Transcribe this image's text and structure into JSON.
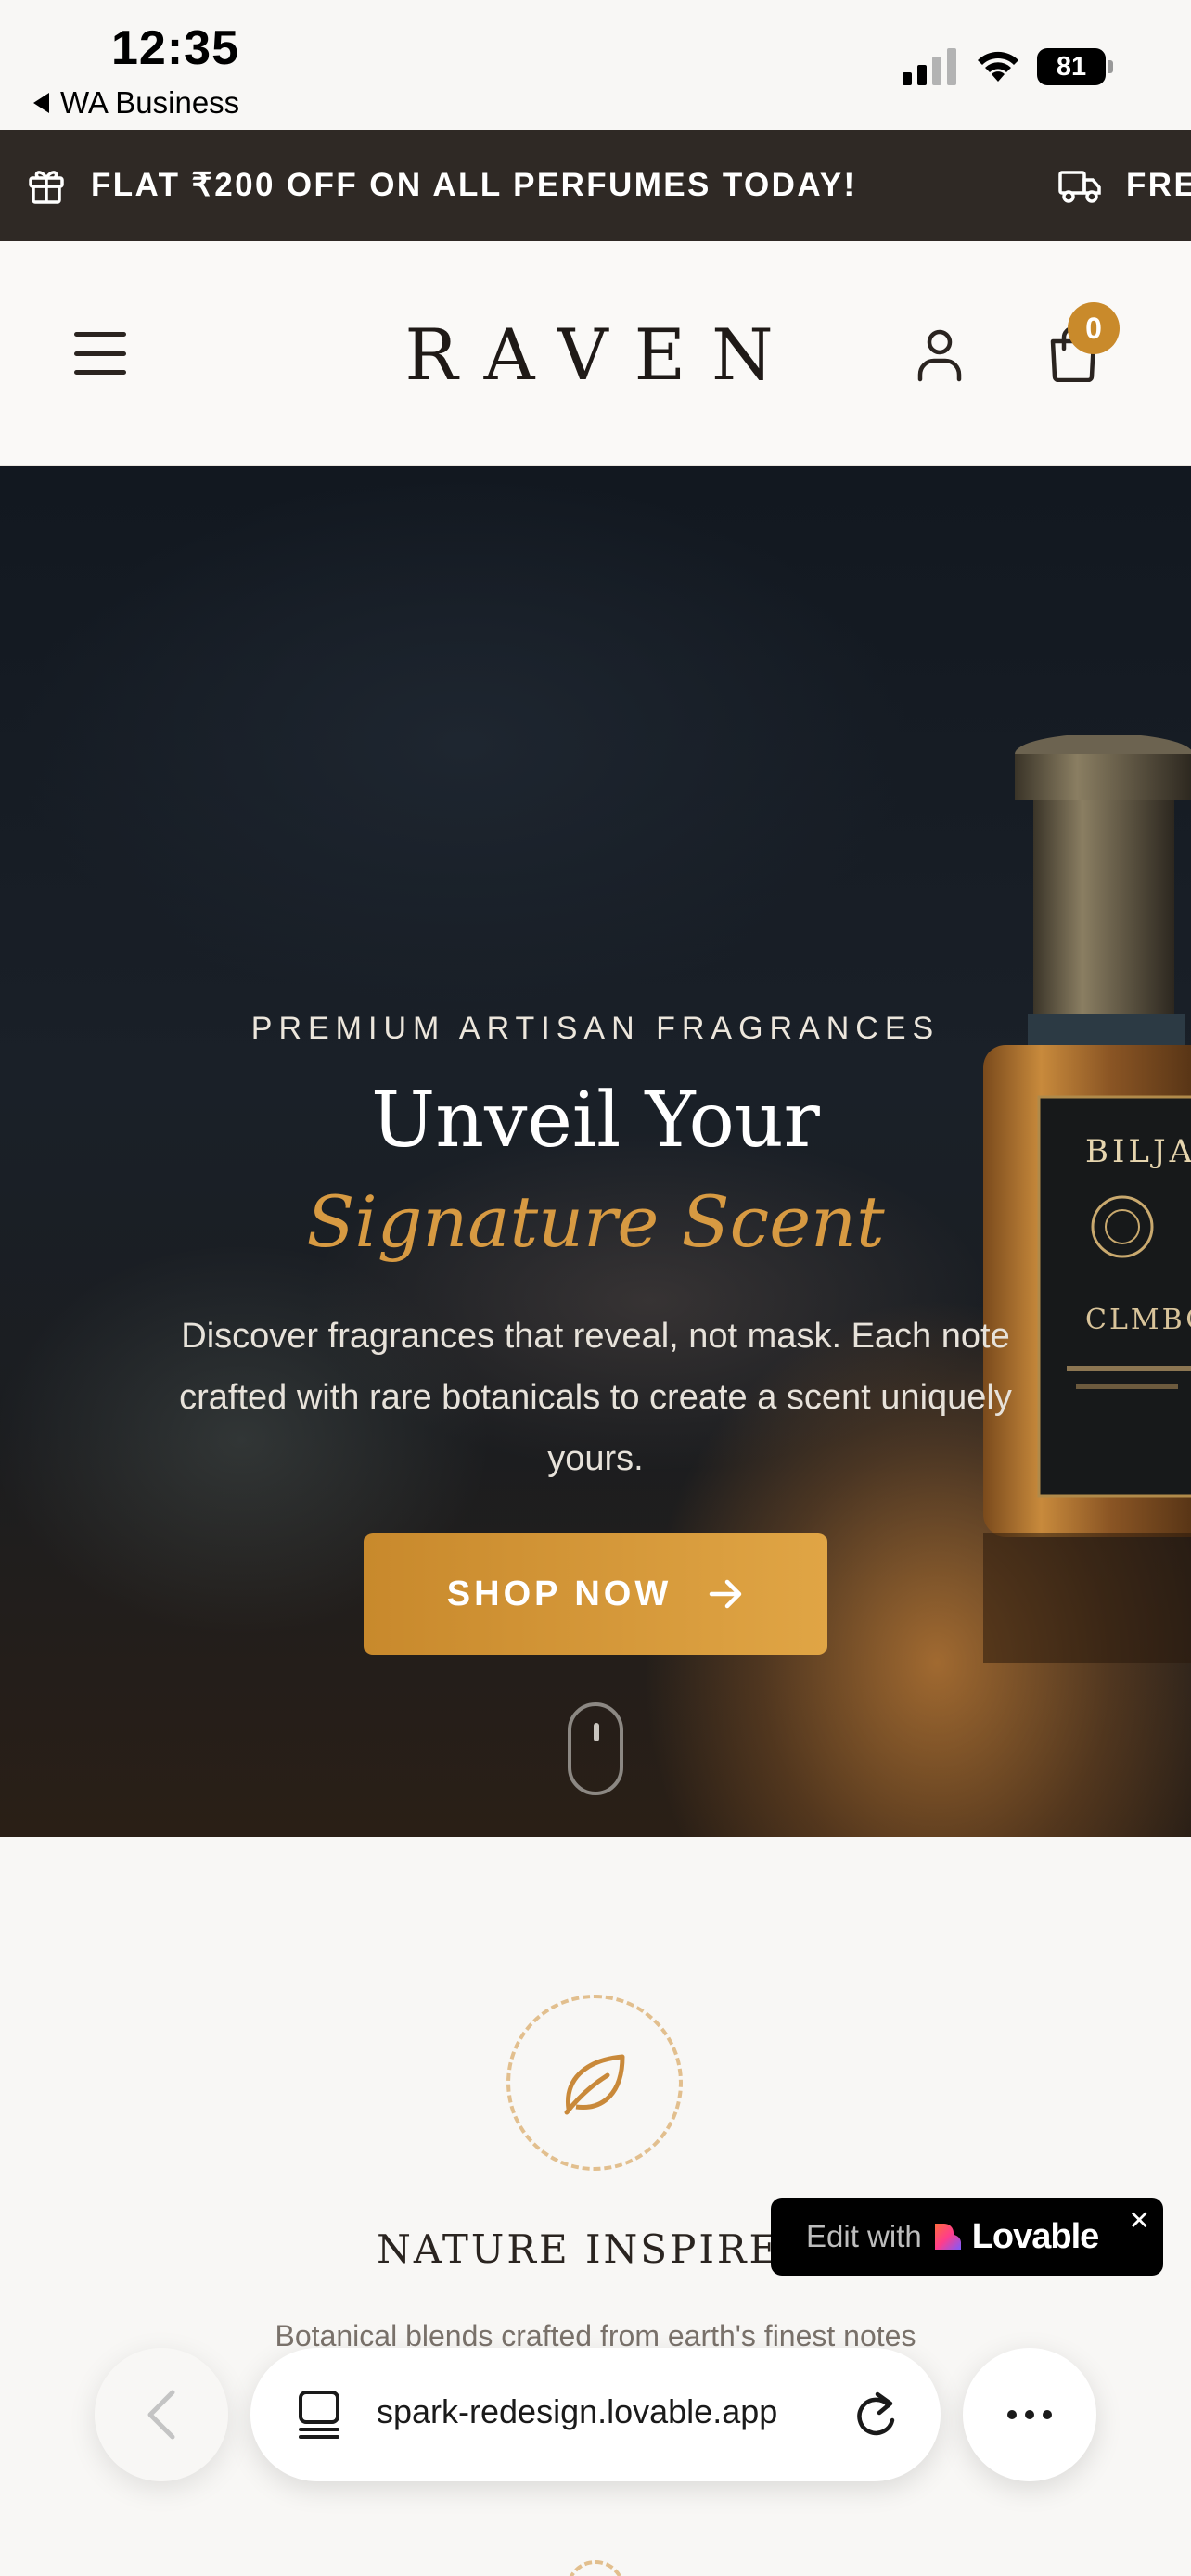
{
  "status_bar": {
    "time": "12:35",
    "back_app": "WA Business",
    "battery": "81",
    "icons": [
      "signal-icon",
      "wifi-icon",
      "battery-icon"
    ]
  },
  "promo": {
    "items": [
      {
        "icon": "gift-icon",
        "text": "FLAT ₹200 OFF ON ALL PERFUMES TODAY!"
      },
      {
        "icon": "truck-icon",
        "text": "FRE"
      }
    ]
  },
  "header": {
    "brand": "RAVEN",
    "cart_count": "0",
    "icons": [
      "menu-icon",
      "user-icon",
      "shopping-bag-icon"
    ]
  },
  "hero": {
    "eyebrow": "PREMIUM ARTISAN FRAGRANCES",
    "title": "Unveil Your",
    "title_accent": "Signature Scent",
    "description": "Discover fragrances that reveal, not mask. Each note crafted with rare botanicals to create a scent uniquely yours.",
    "cta_label": "SHOP NOW",
    "bottle_label": "BILJA",
    "bottle_sub": "CLMBO"
  },
  "features": {
    "items": [
      {
        "icon": "leaf-icon",
        "title": "NATURE INSPIRED",
        "description": "Botanical blends crafted from earth's finest notes"
      }
    ]
  },
  "lovable": {
    "edit_text": "Edit with",
    "brand": "Lovable",
    "close": "✕"
  },
  "browser": {
    "url": "spark-redesign.lovable.app"
  },
  "colors": {
    "accent": "#c98a2b",
    "promo_bg": "#2f2925",
    "hero_accent_text": "#d79a42"
  }
}
